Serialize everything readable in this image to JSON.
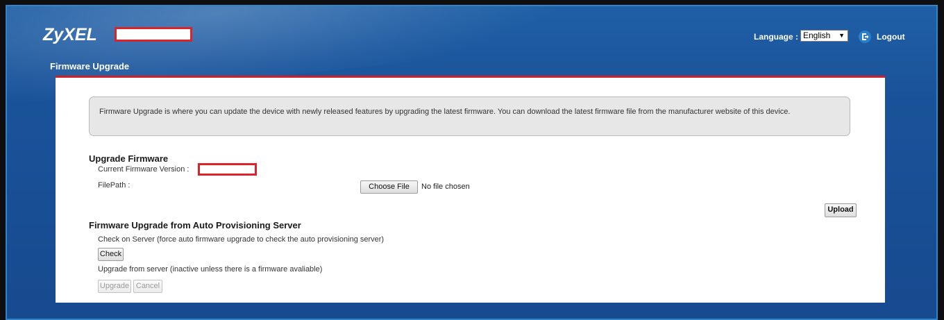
{
  "header": {
    "logo_text": "ZyXEL",
    "language_label": "Language :",
    "language_value": "English",
    "logout_label": "Logout"
  },
  "page": {
    "title": "Firmware Upgrade"
  },
  "info": {
    "text": "Firmware Upgrade is where you can update the device with newly released features by upgrading the latest firmware. You can download the latest firmware file from the manufacturer website of this device."
  },
  "upgrade_firmware": {
    "heading": "Upgrade Firmware",
    "current_version_label": "Current Firmware Version :",
    "filepath_label": "FilePath :",
    "choose_file_label": "Choose File",
    "no_file_text": "No file chosen",
    "upload_label": "Upload"
  },
  "auto_provision": {
    "heading": "Firmware Upgrade from Auto Provisioning Server",
    "check_desc": "Check on Server (force auto firmware upgrade to check the auto provisioning server)",
    "check_label": "Check",
    "upgrade_desc": "Upgrade from server (inactive unless there is a firmware avaliable)",
    "upgrade_label": "Upgrade",
    "cancel_label": "Cancel"
  },
  "colors": {
    "accent_red": "#d0202a",
    "header_blue": "#1a5299"
  }
}
